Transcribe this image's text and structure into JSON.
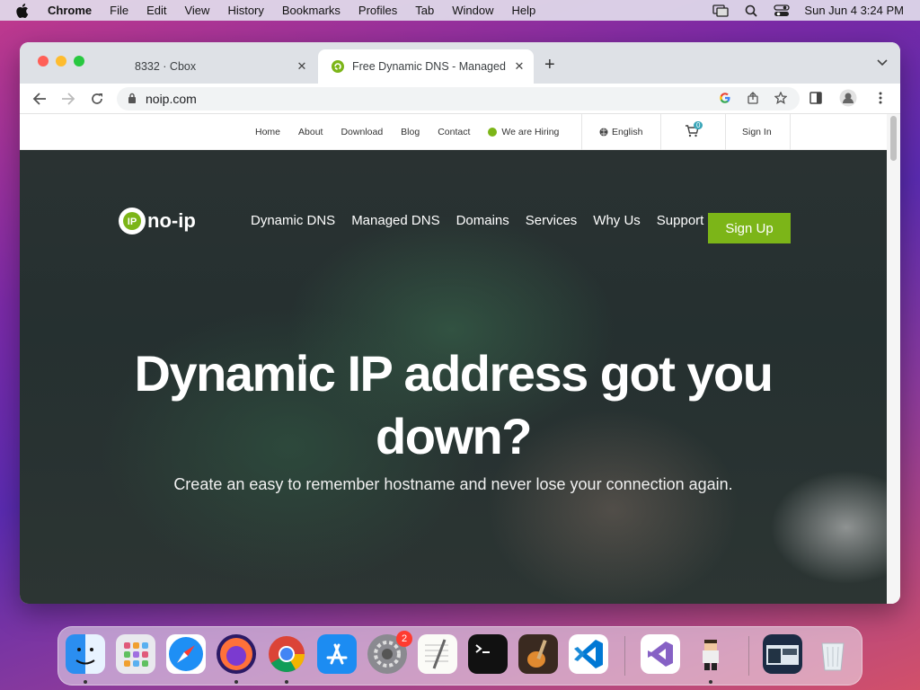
{
  "menubar": {
    "app_name": "Chrome",
    "items": [
      "File",
      "Edit",
      "View",
      "History",
      "Bookmarks",
      "Profiles",
      "Tab",
      "Window",
      "Help"
    ],
    "clock": "Sun Jun 4  3:24 PM"
  },
  "browser": {
    "tabs": [
      {
        "title": "8332 · Cbox",
        "active": false
      },
      {
        "title": "Free Dynamic DNS - Managed",
        "active": true
      }
    ],
    "url": "noip.com"
  },
  "site": {
    "topnav": {
      "links": [
        "Home",
        "About",
        "Download",
        "Blog",
        "Contact"
      ],
      "hiring": "We are Hiring",
      "language": "English",
      "cart_count": "0",
      "signin": "Sign In"
    },
    "mainnav": [
      "Dynamic DNS",
      "Managed DNS",
      "Domains",
      "Services",
      "Why Us",
      "Support"
    ],
    "signup": "Sign Up",
    "logo_text": "no-ip",
    "headline_line1": "Dynamic IP address got you",
    "headline_line2": "down?",
    "subline": "Create an easy to remember hostname and never lose your connection again."
  },
  "dock": {
    "items": [
      "Finder",
      "Launchpad",
      "Safari",
      "Firefox",
      "Chrome",
      "App Store",
      "System Preferences",
      "TextEdit",
      "Terminal",
      "GarageBand",
      "Visual Studio Code",
      "Visual Studio",
      "Game",
      "Screenshot",
      "Trash"
    ],
    "system_prefs_badge": "2"
  }
}
